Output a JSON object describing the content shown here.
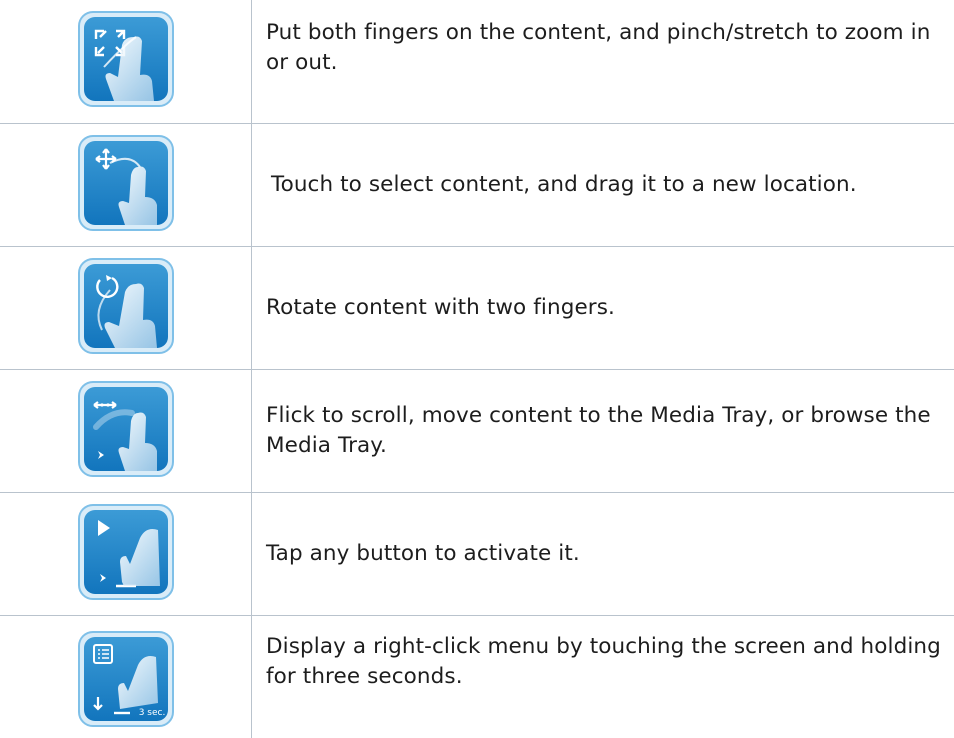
{
  "colors": {
    "border": "#b9c3cd",
    "icon_outer": "#4aa3d8",
    "icon_inner": "#1e84c9",
    "text": "#1d1d1d"
  },
  "gestures": [
    {
      "icon": "pinch-zoom-gesture-icon",
      "text": "Put both fingers on the content, and pinch/stretch to zoom in or out."
    },
    {
      "icon": "drag-gesture-icon",
      "text": "Touch to select content, and drag it to a new location."
    },
    {
      "icon": "rotate-gesture-icon",
      "text": "Rotate content with two fingers."
    },
    {
      "icon": "flick-gesture-icon",
      "text": "Flick to scroll, move content to the Media Tray, or browse the Media Tray."
    },
    {
      "icon": "tap-gesture-icon",
      "text": "Tap any button to activate it."
    },
    {
      "icon": "press-hold-gesture-icon",
      "text": "Display a right-click menu by touching the screen and holding for three seconds.",
      "badge": "3 sec."
    }
  ]
}
